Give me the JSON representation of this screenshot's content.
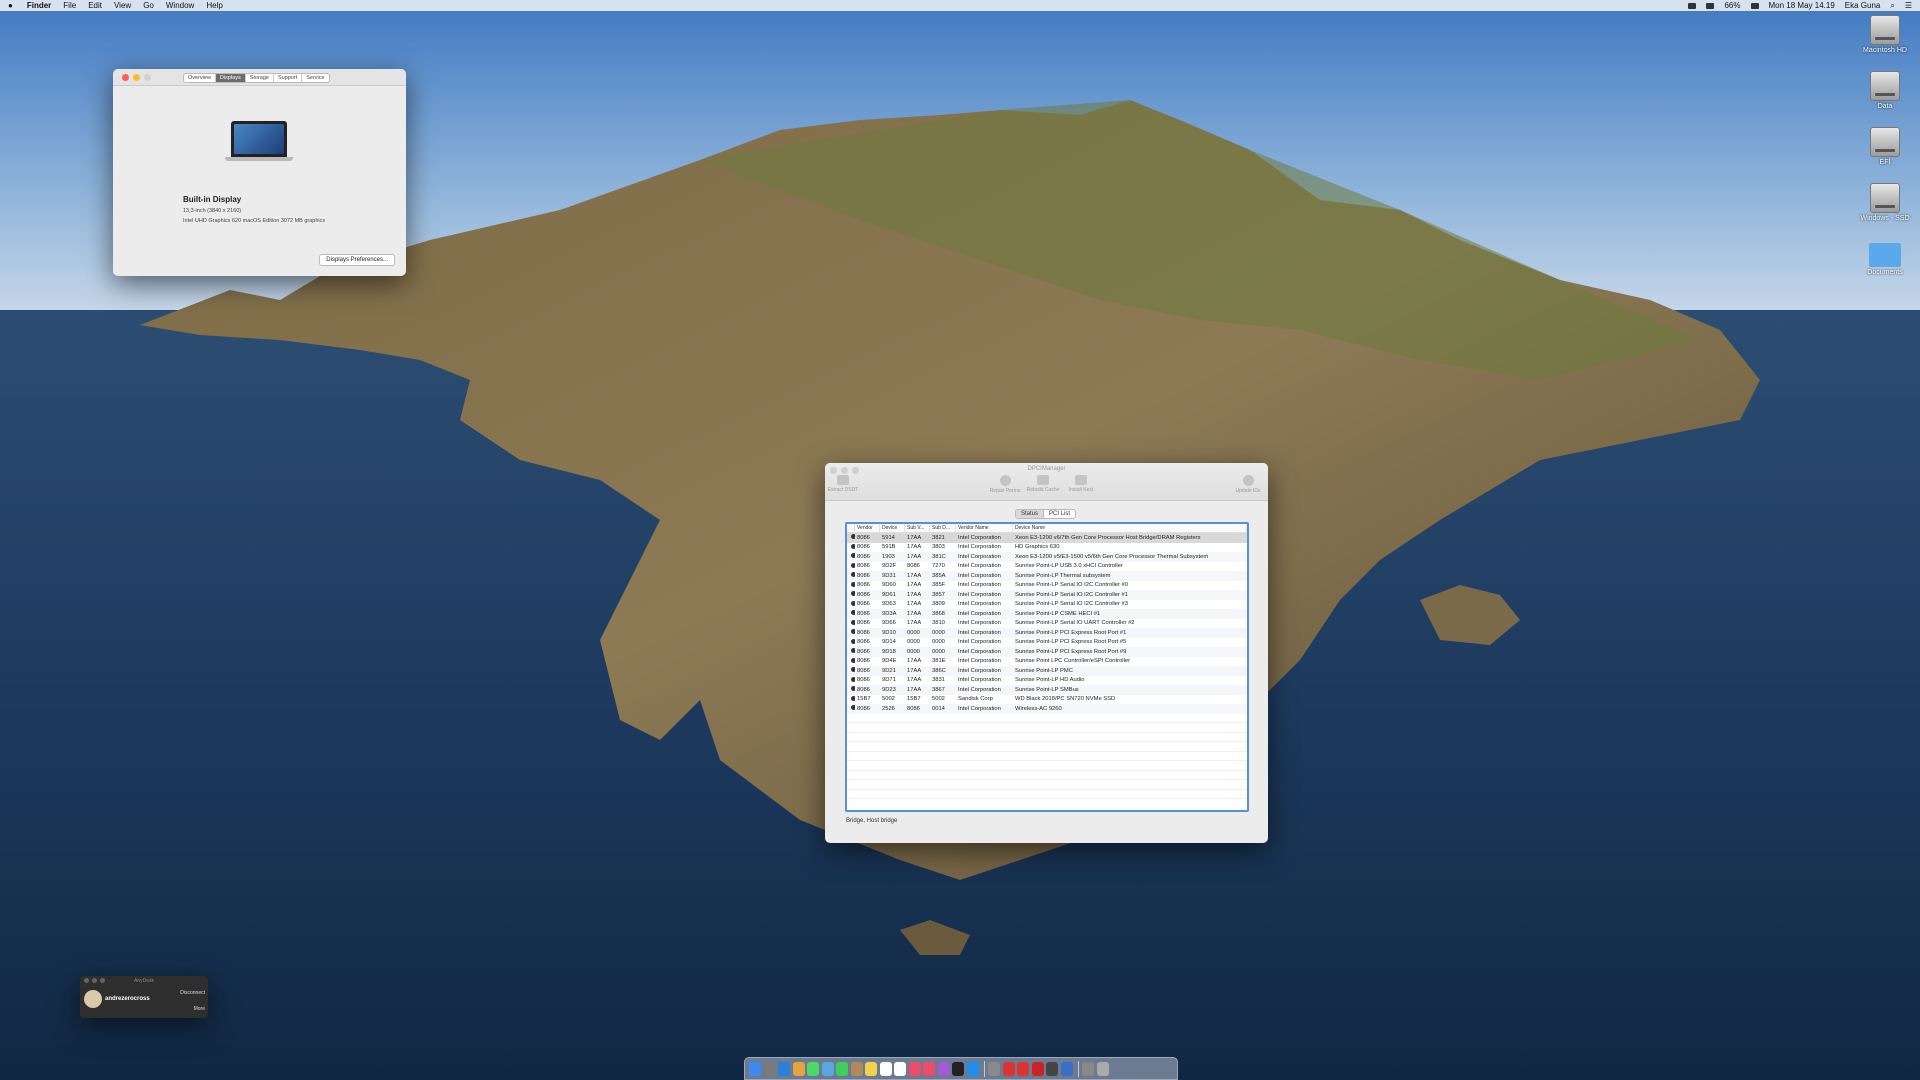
{
  "menubar": {
    "apple": "",
    "app": "Finder",
    "items": [
      "File",
      "Edit",
      "View",
      "Go",
      "Window",
      "Help"
    ],
    "battery": "66%",
    "datetime": "Mon 18 May 14.19",
    "user": "Eka Guna"
  },
  "desktop_icons": [
    "Macintosh HD",
    "Data",
    "EFI",
    "Windows - SSD",
    "Documents"
  ],
  "about_window": {
    "tabs": [
      "Overview",
      "Displays",
      "Storage",
      "Support",
      "Service"
    ],
    "active_tab": "Displays",
    "display_name": "Built-in Display",
    "resolution": "13,3-inch (3840 x 2160)",
    "graphics": "Intel UHD Graphics 620 macOS Edition 3072 MB graphics",
    "prefs_button": "Displays Preferences..."
  },
  "dpci": {
    "title": "DPCIManager",
    "toolbar": {
      "extract": "Extract DSDT",
      "repair": "Repair Perms",
      "rebuild": "Rebuild Cache",
      "install": "Install Kext",
      "update": "Update IDs"
    },
    "tabs": [
      "Status",
      "PCI List"
    ],
    "columns": [
      "",
      "Vendor",
      "Device",
      "Sub V...",
      "Sub D...",
      "Vendor Name",
      "Device Name"
    ],
    "rows": [
      [
        "8086",
        "5914",
        "17AA",
        "3821",
        "Intel Corporation",
        "Xeon E3-1200 v6/7th Gen Core Processor Host Bridge/DRAM Registers"
      ],
      [
        "8086",
        "591B",
        "17AA",
        "3803",
        "Intel Corporation",
        "HD Graphics 630"
      ],
      [
        "8086",
        "1903",
        "17AA",
        "381C",
        "Intel Corporation",
        "Xeon E3-1200 v5/E3-1500 v5/6th Gen Core Processor Thermal Subsystem"
      ],
      [
        "8086",
        "9D2F",
        "8086",
        "7270",
        "Intel Corporation",
        "Sunrise Point-LP USB 3.0 xHCI Controller"
      ],
      [
        "8086",
        "9D31",
        "17AA",
        "385A",
        "Intel Corporation",
        "Sunrise Point-LP Thermal subsystem"
      ],
      [
        "8086",
        "9D60",
        "17AA",
        "385F",
        "Intel Corporation",
        "Sunrise Point-LP Serial IO I2C Controller #0"
      ],
      [
        "8086",
        "9D61",
        "17AA",
        "3857",
        "Intel Corporation",
        "Sunrise Point-LP Serial IO I2C Controller #1"
      ],
      [
        "8086",
        "9D63",
        "17AA",
        "3809",
        "Intel Corporation",
        "Sunrise Point-LP Serial IO I2C Controller #3"
      ],
      [
        "8086",
        "9D3A",
        "17AA",
        "3868",
        "Intel Corporation",
        "Sunrise Point-LP CSME HECI #1"
      ],
      [
        "8086",
        "9D66",
        "17AA",
        "3810",
        "Intel Corporation",
        "Sunrise Point-LP Serial IO UART Controller #2"
      ],
      [
        "8086",
        "9D10",
        "0000",
        "0000",
        "Intel Corporation",
        "Sunrise Point-LP PCI Express Root Port #1"
      ],
      [
        "8086",
        "9D14",
        "0000",
        "0000",
        "Intel Corporation",
        "Sunrise Point-LP PCI Express Root Port #5"
      ],
      [
        "8086",
        "9D18",
        "0000",
        "0000",
        "Intel Corporation",
        "Sunrise Point-LP PCI Express Root Port #9"
      ],
      [
        "8086",
        "9D4E",
        "17AA",
        "381E",
        "Intel Corporation",
        "Sunrise Point LPC Controller/eSPI Controller"
      ],
      [
        "8086",
        "9D21",
        "17AA",
        "386C",
        "Intel Corporation",
        "Sunrise Point-LP PMC"
      ],
      [
        "8086",
        "9D71",
        "17AA",
        "3831",
        "Intel Corporation",
        "Sunrise Point-LP HD Audio"
      ],
      [
        "8086",
        "9D23",
        "17AA",
        "3867",
        "Intel Corporation",
        "Sunrise Point-LP SMBus"
      ],
      [
        "15B7",
        "5002",
        "15B7",
        "5002",
        "Sandisk Corp",
        "WD Black 2018/PC SN720 NVMe SSD"
      ],
      [
        "8086",
        "2526",
        "8086",
        "0014",
        "Intel Corporation",
        "Wireless-AC 9260"
      ]
    ],
    "status_text": "Bridge, Host bridge"
  },
  "anydesk": {
    "title": "AnyDesk",
    "user": "andrezerocross",
    "disconnect": "Disconnect",
    "more": "More"
  },
  "dock": {
    "apps": [
      "finder",
      "launchpad",
      "safari",
      "photos",
      "messages",
      "maps",
      "facetime",
      "contacts",
      "notes",
      "calendar",
      "reminders",
      "itunes",
      "music",
      "podcasts",
      "appletv",
      "appstore",
      "preferences",
      "app1",
      "app2",
      "app3",
      "app4",
      "app5",
      "app6",
      "app7"
    ],
    "colors": [
      "#3d8af7",
      "#7a7a7a",
      "#2a7fd6",
      "#e8a33d",
      "#4cd964",
      "#5aa7e0",
      "#3ccf5a",
      "#b08a5a",
      "#f2d24b",
      "#ffffff",
      "#ffffff",
      "#f04b6b",
      "#f04b6b",
      "#a35ad8",
      "#222222",
      "#1f8ef1",
      "#8a8a8a",
      "#d33",
      "#d33",
      "#c22",
      "#444",
      "#3a6ec7",
      "#888",
      "#aaa"
    ]
  }
}
